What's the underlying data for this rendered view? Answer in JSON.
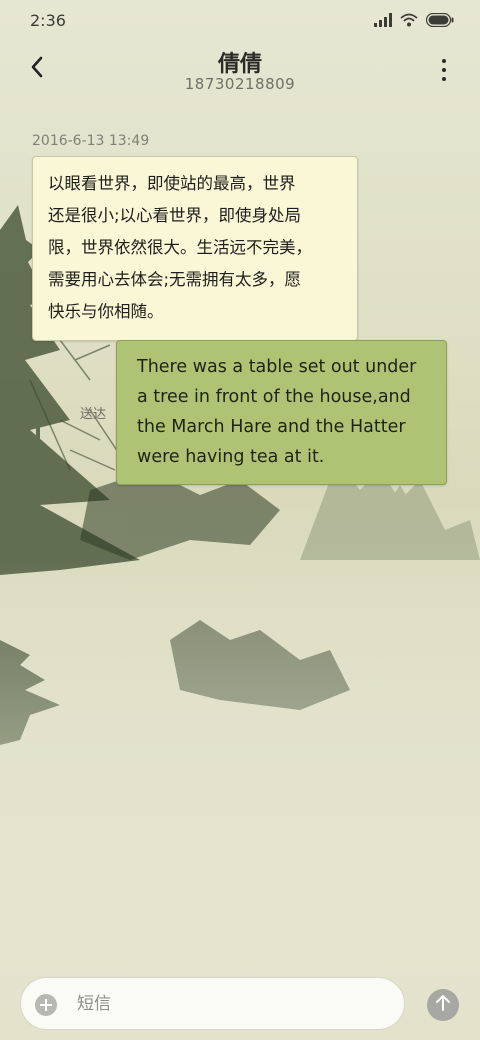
{
  "status_bar": {
    "time": "2:36",
    "icons": [
      "signal-icon",
      "wifi-icon",
      "battery-icon"
    ]
  },
  "header": {
    "back_icon": "chevron-left-icon",
    "contact_name": "倩倩",
    "contact_number": "18730218809",
    "more_icon": "more-vertical-icon"
  },
  "conversation": {
    "timestamp": "2016-6-13 13:49",
    "messages": [
      {
        "direction": "incoming",
        "lines": [
          "以眼看世界，即使站的最高，世界",
          "还是很小;以心看世界，即使身处局",
          "限，世界依然很大。生活远不完美，",
          "需要用心去体会;无需拥有太多，愿",
          "快乐与你相随。"
        ]
      },
      {
        "direction": "outgoing",
        "lines": [
          "There was a table set out under",
          "a tree in front of the house,and",
          "the March Hare and the Hatter",
          "were having tea at it."
        ],
        "status": "送达"
      }
    ]
  },
  "compose": {
    "add_icon": "plus-circle-icon",
    "placeholder": "短信",
    "value": "",
    "send_icon": "arrow-up-icon"
  },
  "colors": {
    "incoming_bubble": "#faf7d7",
    "outgoing_bubble": "#aec474",
    "background": "#dfe0c6"
  }
}
